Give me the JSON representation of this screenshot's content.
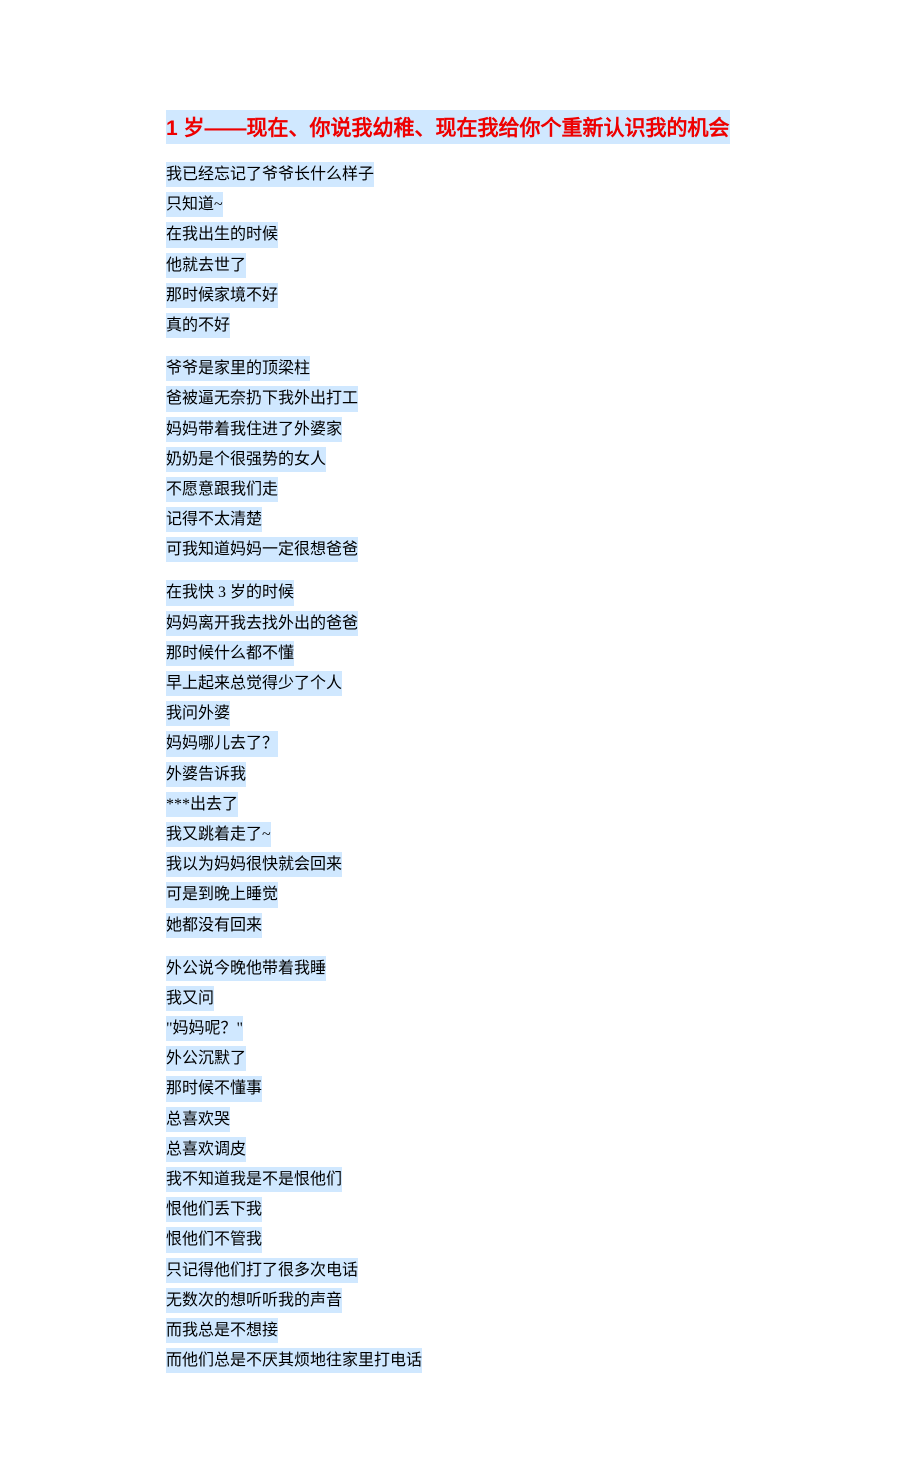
{
  "title": "1 岁——现在、你说我幼稚、现在我给你个重新认识我的机会",
  "stanzas": [
    {
      "lines": [
        "我已经忘记了爷爷长什么样子",
        "只知道~",
        "在我出生的时候",
        "他就去世了",
        "那时候家境不好",
        "真的不好"
      ]
    },
    {
      "lines": [
        "爷爷是家里的顶梁柱",
        "爸被逼无奈扔下我外出打工",
        "妈妈带着我住进了外婆家",
        "奶奶是个很强势的女人",
        "不愿意跟我们走",
        "记得不太清楚",
        "可我知道妈妈一定很想爸爸"
      ]
    },
    {
      "lines": [
        "在我快 3 岁的时候",
        "妈妈离开我去找外出的爸爸",
        "那时候什么都不懂",
        "早上起来总觉得少了个人",
        "我问外婆",
        "妈妈哪儿去了？",
        "外婆告诉我",
        "***出去了",
        "我又跳着走了~",
        "我以为妈妈很快就会回来",
        "可是到晚上睡觉",
        "她都没有回来"
      ]
    },
    {
      "lines": [
        "外公说今晚他带着我睡",
        "我又问",
        "\"妈妈呢？\"",
        "外公沉默了",
        "那时候不懂事",
        "总喜欢哭",
        "总喜欢调皮",
        "我不知道我是不是恨他们",
        "恨他们丢下我",
        "恨他们不管我",
        "只记得他们打了很多次电话",
        "无数次的想听听我的声音",
        "而我总是不想接",
        "而他们总是不厌其烦地往家里打电话"
      ]
    }
  ]
}
